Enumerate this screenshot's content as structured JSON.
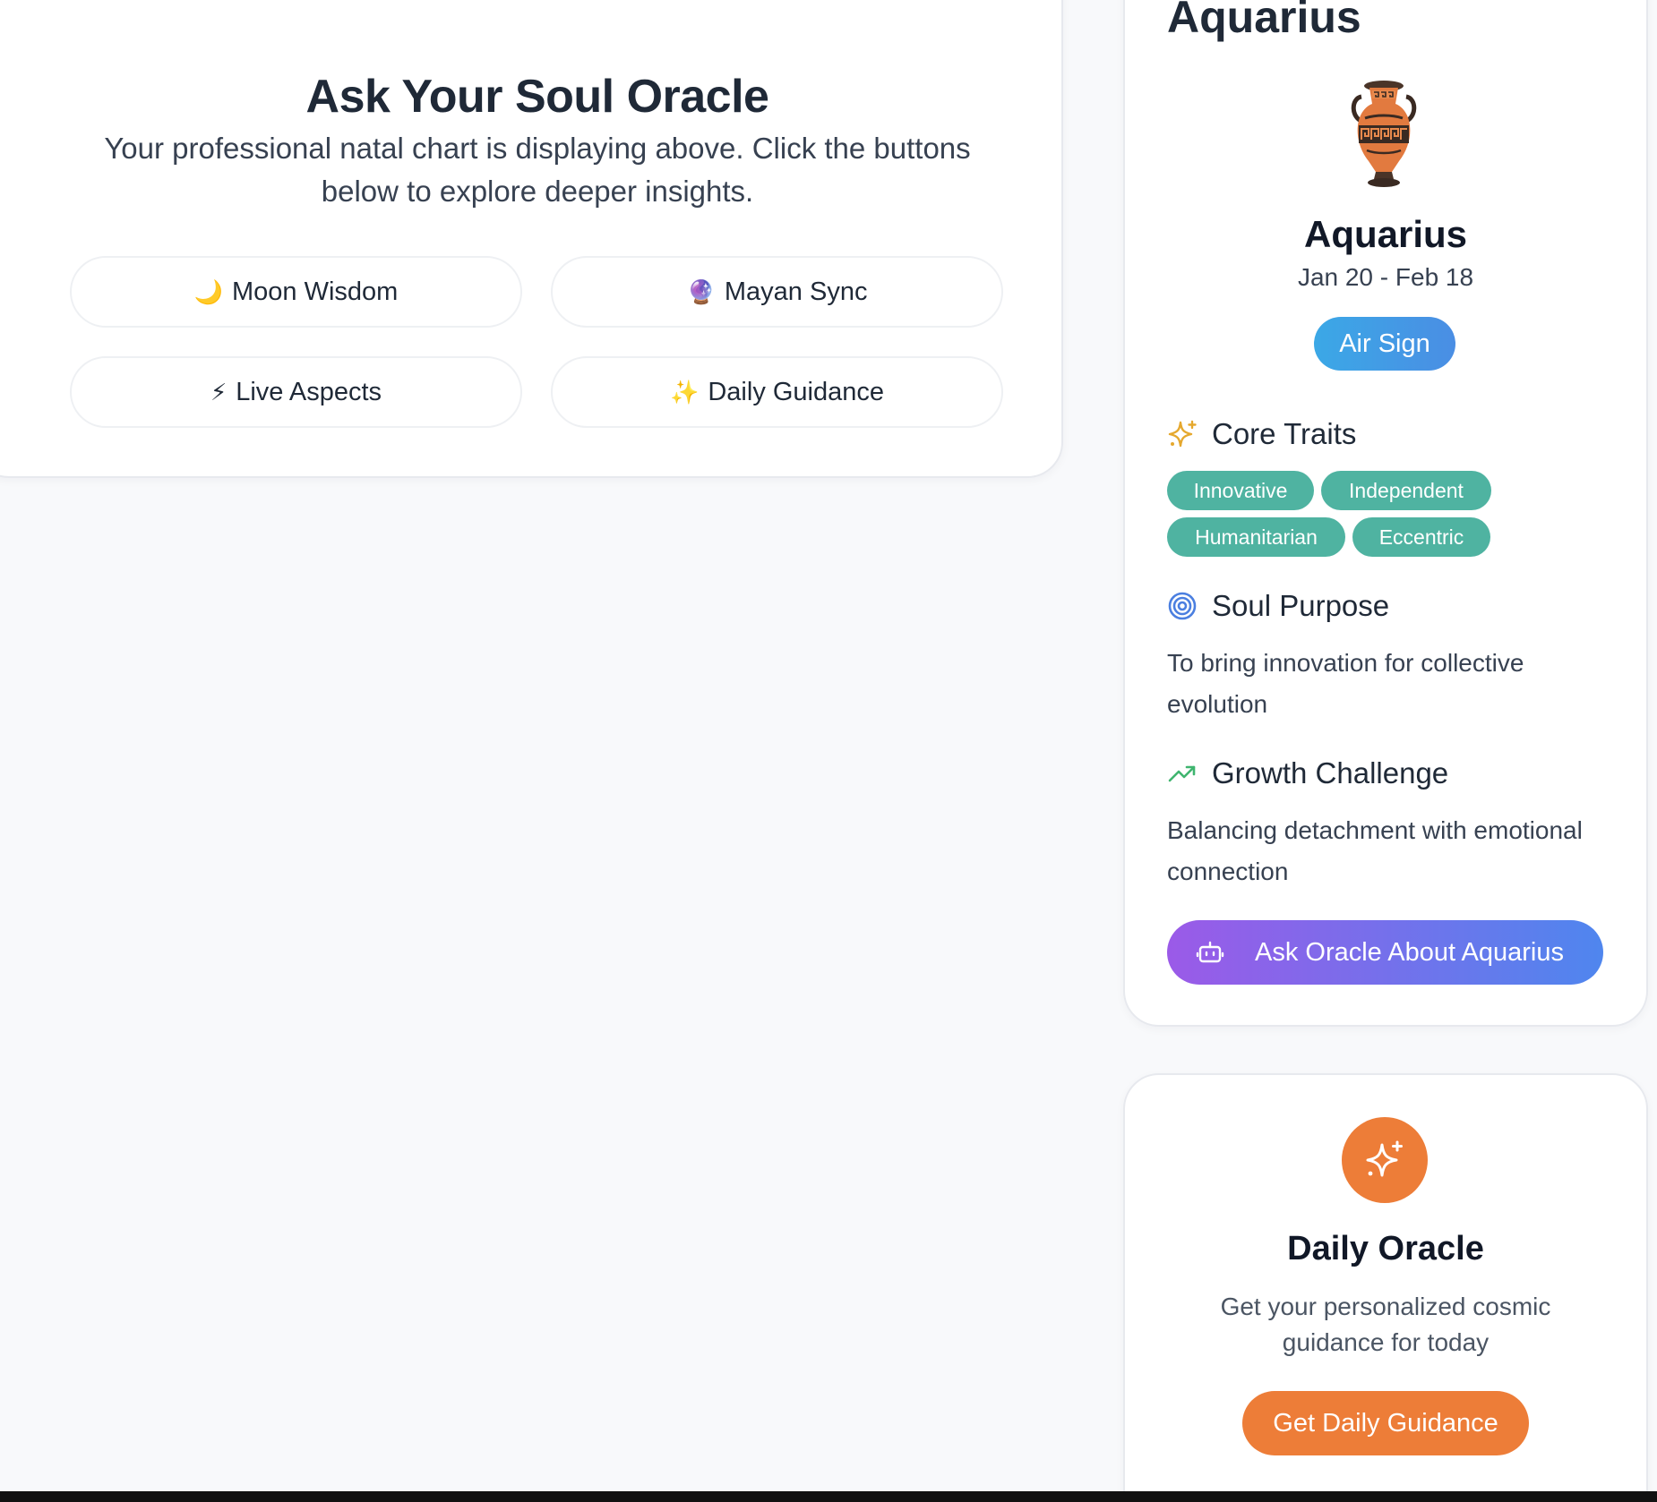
{
  "oracle": {
    "title": "Ask Your Soul Oracle",
    "subtitle": "Your professional natal chart is displaying above. Click the buttons below to explore deeper insights.",
    "buttons": [
      {
        "emoji": "🌙",
        "label": "Moon Wisdom"
      },
      {
        "emoji": "🔮",
        "label": "Mayan Sync"
      },
      {
        "emoji": "⚡",
        "label": "Live Aspects"
      },
      {
        "emoji": "✨",
        "label": "Daily Guidance"
      }
    ]
  },
  "sign_card": {
    "heading": "Aquarius",
    "icon": "amphora-icon",
    "name": "Aquarius",
    "dates": "Jan 20 - Feb 18",
    "element": "Air Sign",
    "core_traits": {
      "title": "Core Traits",
      "icon": "sparkles-icon",
      "traits": [
        "Innovative",
        "Independent",
        "Humanitarian",
        "Eccentric"
      ]
    },
    "soul_purpose": {
      "title": "Soul Purpose",
      "icon": "target-icon",
      "text": "To bring innovation for collective evolution"
    },
    "growth_challenge": {
      "title": "Growth Challenge",
      "icon": "trending-up-icon",
      "text": "Balancing detachment with emotional connection"
    },
    "ask_button": "Ask Oracle About Aquarius"
  },
  "daily_oracle": {
    "icon": "sparkles-icon",
    "title": "Daily Oracle",
    "subtitle": "Get your personalized cosmic guidance for today",
    "button": "Get Daily Guidance"
  },
  "colors": {
    "trait_chip": "#4fb3a1",
    "air_badge": "#3ba8e6",
    "ask_gradient_start": "#9b5ae8",
    "ask_gradient_end": "#4f86ee",
    "daily_accent": "#ed7d38"
  }
}
